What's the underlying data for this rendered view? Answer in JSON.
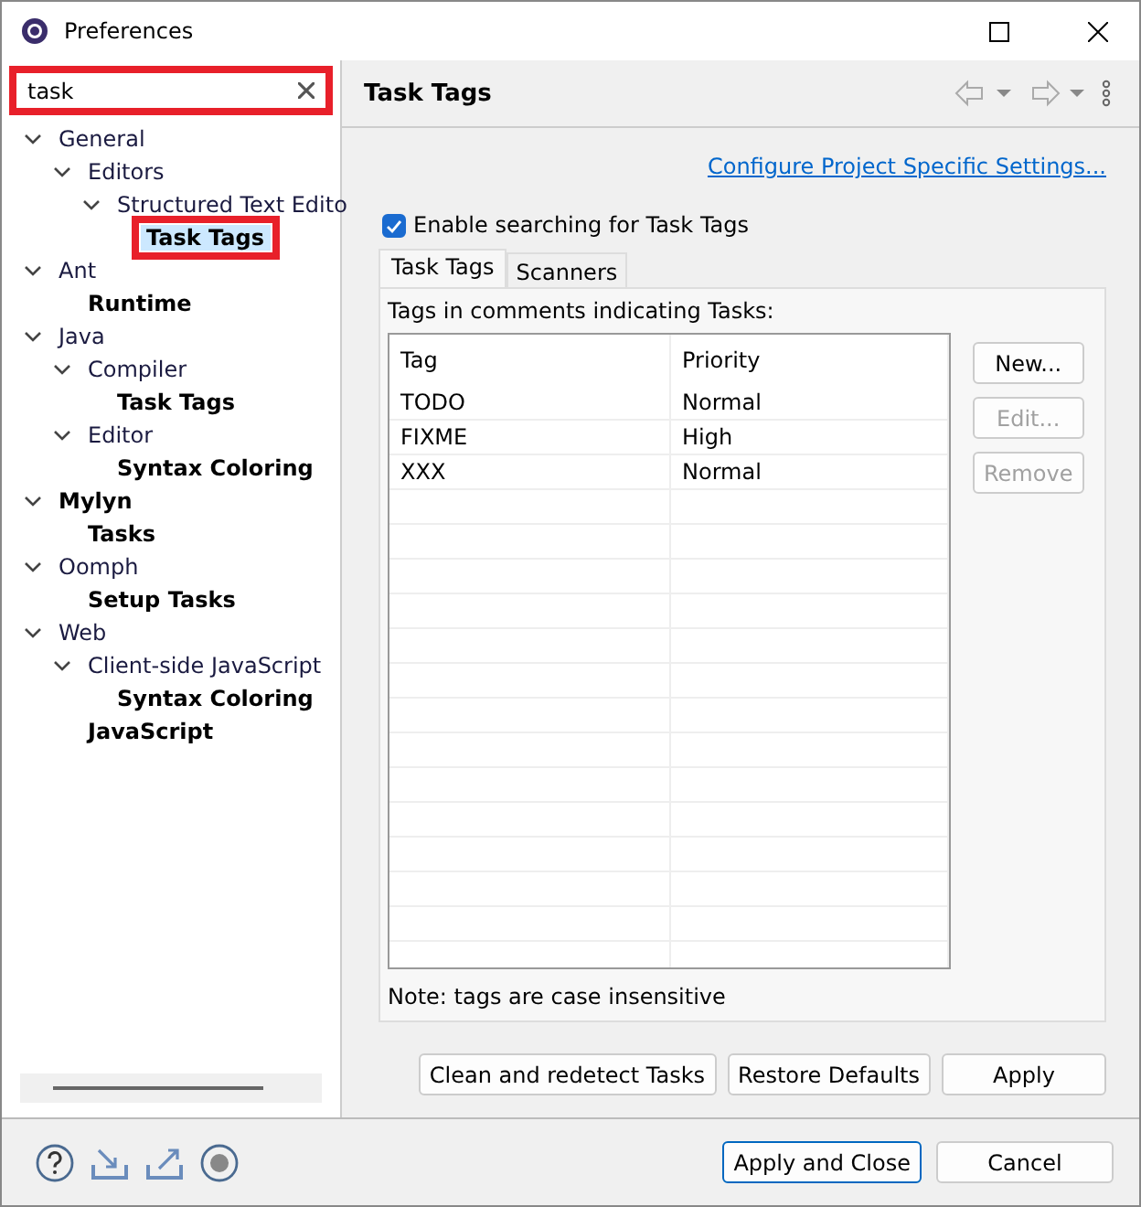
{
  "window": {
    "title": "Preferences"
  },
  "search": {
    "value": "task",
    "annotated": true
  },
  "tree": [
    {
      "label": "General",
      "match": false,
      "selected": false,
      "children": [
        {
          "label": "Editors",
          "match": false,
          "selected": false,
          "children": [
            {
              "label": "Structured Text Edito",
              "match": false,
              "selected": false,
              "children": [
                {
                  "label": "Task Tags",
                  "match": true,
                  "selected": true
                }
              ]
            }
          ]
        }
      ]
    },
    {
      "label": "Ant",
      "match": false,
      "selected": false,
      "children": [
        {
          "label": "Runtime",
          "match": true,
          "selected": false
        }
      ]
    },
    {
      "label": "Java",
      "match": false,
      "selected": false,
      "children": [
        {
          "label": "Compiler",
          "match": false,
          "selected": false,
          "children": [
            {
              "label": "Task Tags",
              "match": true,
              "selected": false
            }
          ]
        },
        {
          "label": "Editor",
          "match": false,
          "selected": false,
          "children": [
            {
              "label": "Syntax Coloring",
              "match": true,
              "selected": false
            }
          ]
        }
      ]
    },
    {
      "label": "Mylyn",
      "match": true,
      "selected": false,
      "children": [
        {
          "label": "Tasks",
          "match": true,
          "selected": false
        }
      ]
    },
    {
      "label": "Oomph",
      "match": false,
      "selected": false,
      "children": [
        {
          "label": "Setup Tasks",
          "match": true,
          "selected": false
        }
      ]
    },
    {
      "label": "Web",
      "match": false,
      "selected": false,
      "children": [
        {
          "label": "Client-side JavaScript",
          "match": false,
          "selected": false,
          "children": [
            {
              "label": "Syntax Coloring",
              "match": true,
              "selected": false
            }
          ]
        },
        {
          "label": "JavaScript",
          "match": true,
          "selected": false
        }
      ]
    }
  ],
  "page": {
    "title": "Task Tags",
    "link": "Configure Project Specific Settings...",
    "enable": {
      "label": "Enable searching for Task Tags",
      "checked": true
    },
    "tabs": [
      {
        "label": "Task Tags",
        "selected": true
      },
      {
        "label": "Scanners",
        "selected": false
      }
    ],
    "table_caption": "Tags in comments indicating Tasks:",
    "columns": [
      "Tag",
      "Priority"
    ],
    "rows": [
      [
        "TODO",
        "Normal"
      ],
      [
        "FIXME",
        "High"
      ],
      [
        "XXX",
        "Normal"
      ]
    ],
    "side_buttons": [
      {
        "label": "New...",
        "disabled": false
      },
      {
        "label": "Edit...",
        "disabled": true
      },
      {
        "label": "Remove",
        "disabled": true
      }
    ],
    "note": "Note: tags are case insensitive",
    "buttons": [
      "Clean and redetect Tasks",
      "Restore Defaults",
      "Apply"
    ]
  },
  "footer_buttons": [
    {
      "label": "Apply and Close",
      "default": true
    },
    {
      "label": "Cancel",
      "default": false
    }
  ]
}
